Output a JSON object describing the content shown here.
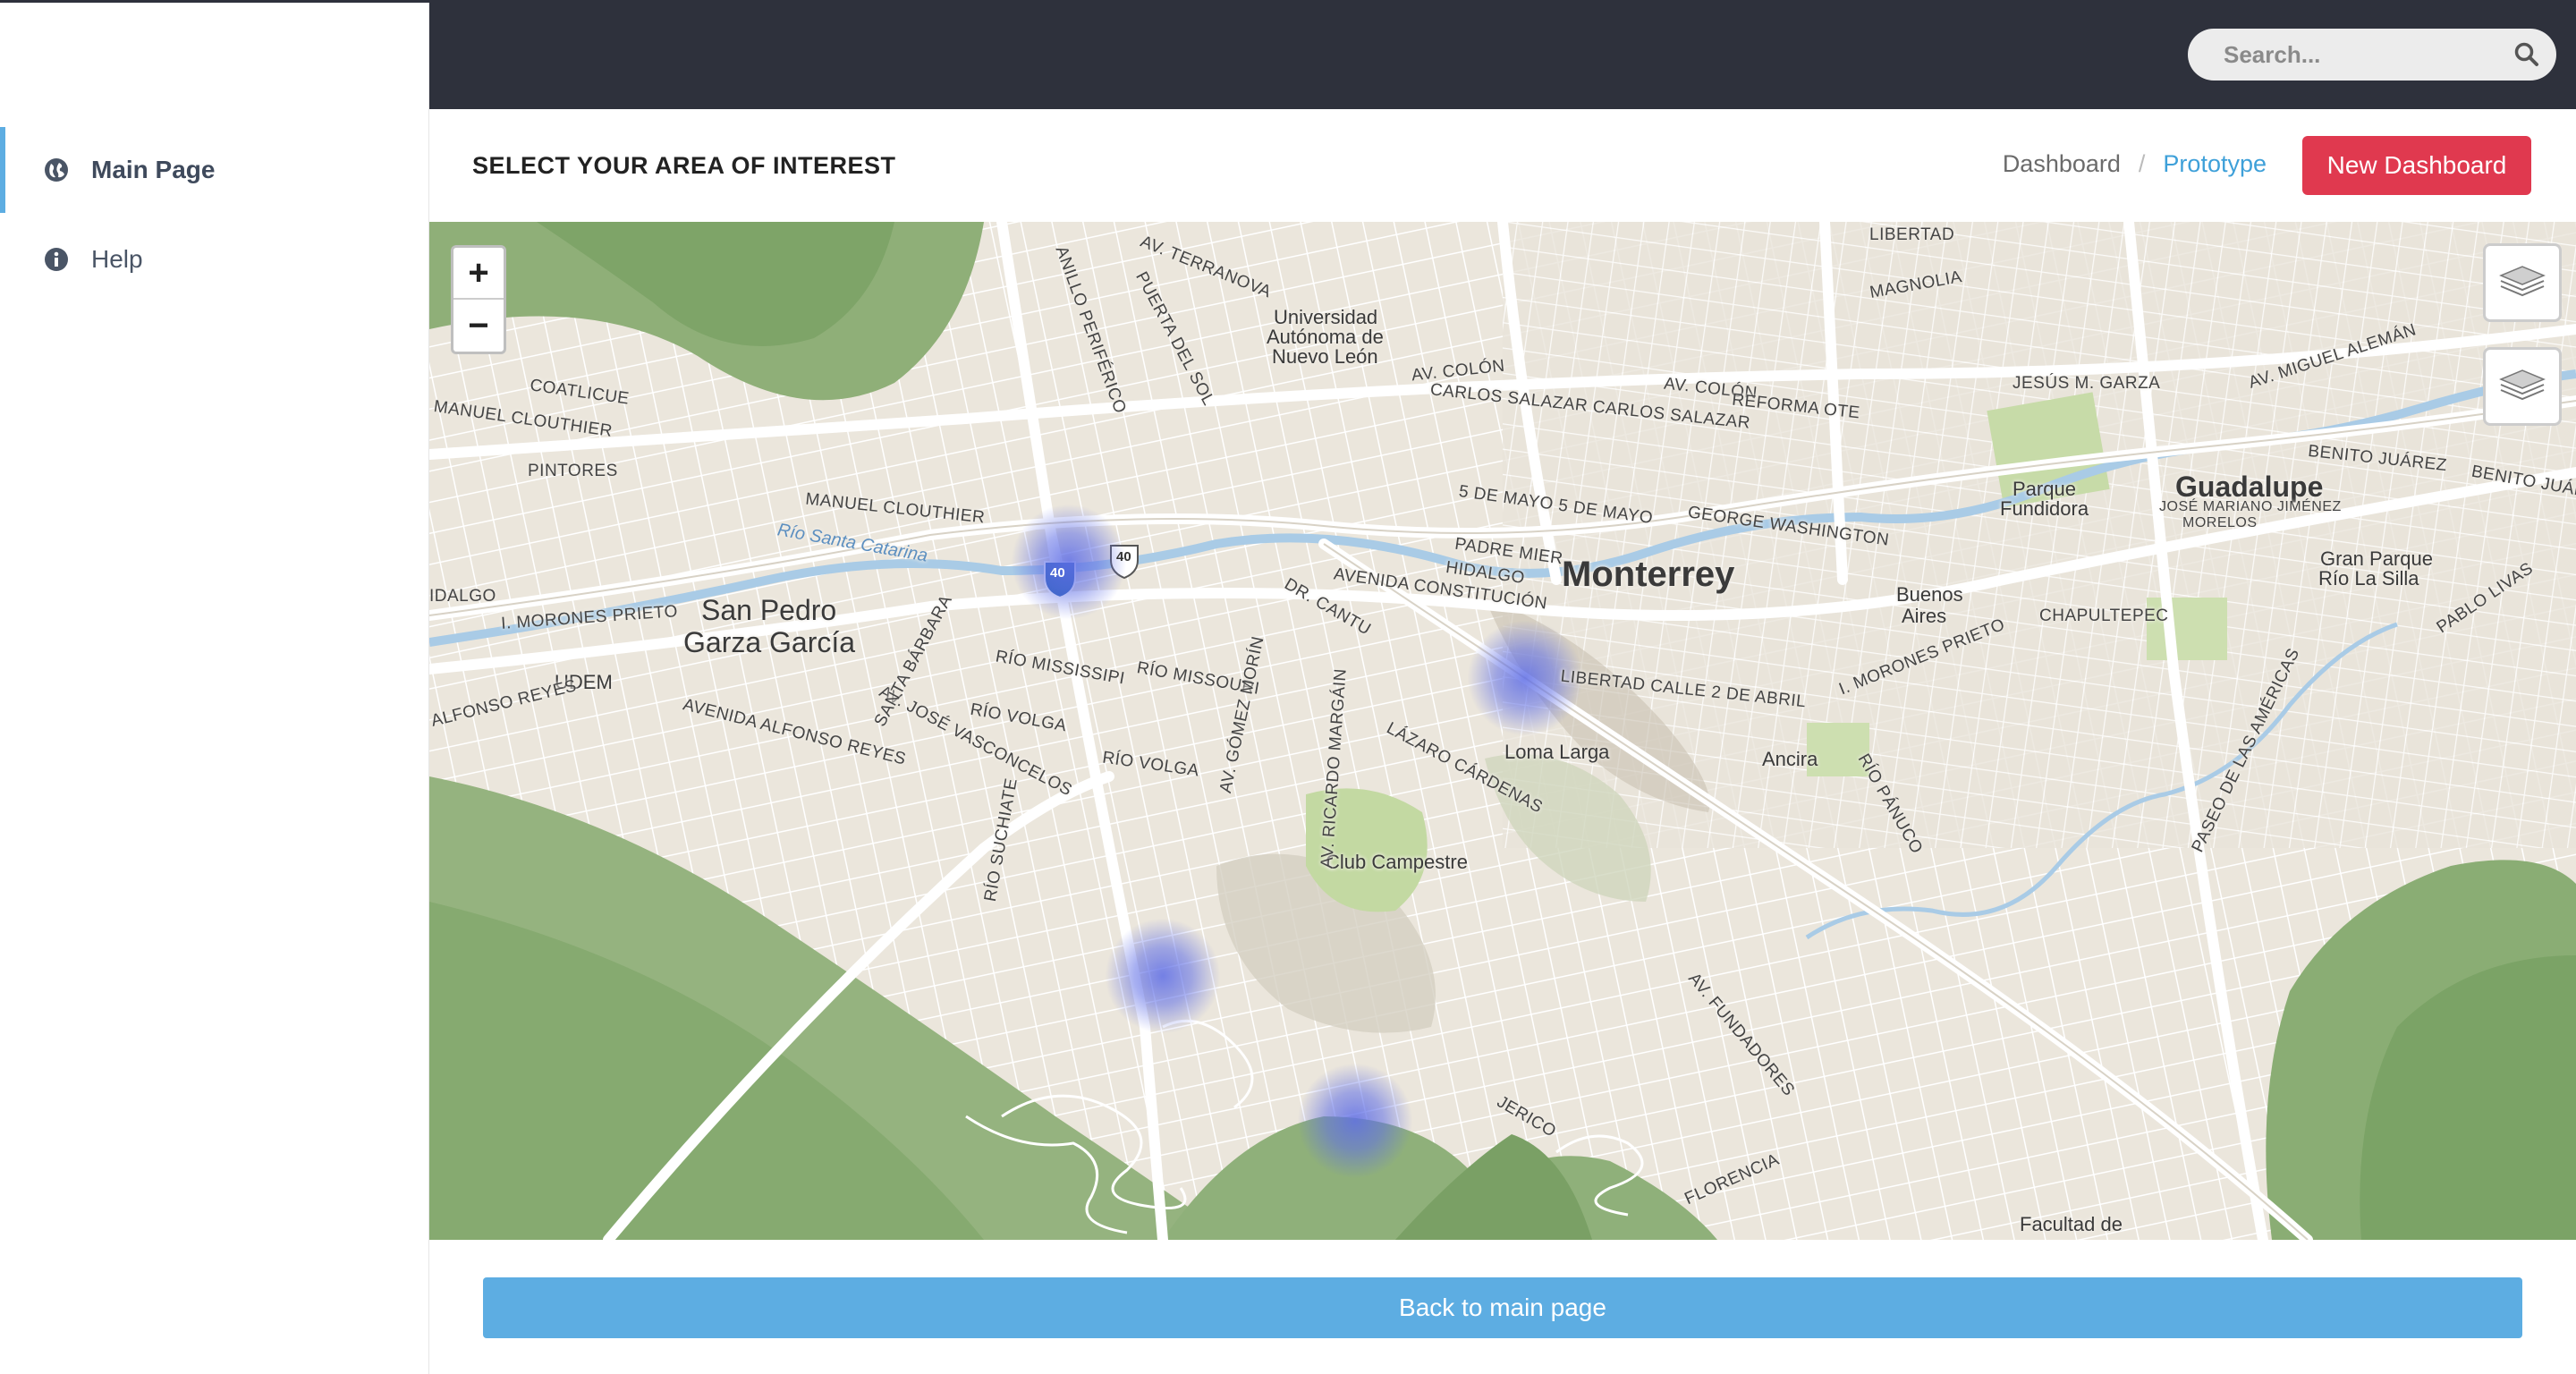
{
  "sidebar": {
    "items": [
      {
        "label": "Main Page",
        "icon": "globe-icon",
        "active": true
      },
      {
        "label": "Help",
        "icon": "info-icon",
        "active": false
      }
    ]
  },
  "topbar": {
    "search_placeholder": "Search..."
  },
  "header": {
    "title": "SELECT YOUR AREA OF INTEREST",
    "breadcrumb": [
      "Dashboard",
      "Prototype"
    ],
    "breadcrumb_separator": "/",
    "new_button": "New Dashboard"
  },
  "map": {
    "zoom_in": "+",
    "zoom_out": "−",
    "labels": {
      "city_monterrey": "Monterrey",
      "city_guadalupe": "Guadalupe",
      "city_san_pedro_1": "San Pedro",
      "city_san_pedro_2": "Garza García",
      "uni_1": "Universidad",
      "uni_2": "Autónoma de",
      "uni_3": "Nuevo León",
      "loma_larga": "Loma Larga",
      "club_campestre": "Club Campestre",
      "ancira": "Ancira",
      "buenos_aires_1": "Buenos",
      "buenos_aires_2": "Aires",
      "parque_fundidora_1": "Parque",
      "parque_fundidora_2": "Fundidora",
      "gran_parque_1": "Gran Parque",
      "gran_parque_2": "Río La Silla",
      "udem": "UDEM",
      "facultad": "Facultad de",
      "coatlicue": "COATLICUE",
      "manuel_clouthier": "MANUEL CLOUTHIER",
      "pintores": "PINTORES",
      "manuel_clouthier_2": "MANUEL CLOUTHIER",
      "rio_santa_catarina": "Río Santa Catarina",
      "morones_prieto": "I. MORONES PRIETO",
      "av_constitucion": "AVENIDA CONSTITUCIÓN",
      "av_colon": "AV. COLÓN",
      "av_colon_2": "AV. COLÓN",
      "carlos_salazar": "CARLOS SALAZAR CARLOS SALAZAR",
      "reforma": "REFORMA OTE",
      "cinco_mayo": "5 DE MAYO  5 DE MAYO",
      "george_washington": "GEORGE WASHINGTON",
      "padre_mier": "PADRE MIER",
      "hidalgo": "HIDALGO",
      "libertad": "LIBERTAD  CALLE 2 DE ABRIL",
      "lazaro_cardenas": "LÁZARO CÁRDENAS",
      "rio_mississipi": "RÍO MISSISSIPI",
      "rio_missouri": "RÍO MISSOURI",
      "rio_volga": "RÍO VOLGA",
      "rio_volga_2": "RÍO VOLGA",
      "alfonso_reyes": "AVENIDA ALFONSO REYES",
      "jose_vasconcelos": "AV. JOSÉ VASCONCELOS",
      "chapultepec": "CHAPULTEPEC",
      "av_fundadores": "AV. FUNDADORES",
      "jerico": "JERICO",
      "florencia": "FLORENCIA",
      "rio_panuco": "RÍO PÁNUCO",
      "paseo_americas": "PASEO DE LAS AMÉRICAS",
      "magnolia": "MAGNOLIA",
      "jesus_garza": "JESÚS M. GARZA",
      "miguel_aleman": "AV. MIGUEL ALEMÁN",
      "benito_juarez": "BENITO JUÁREZ",
      "benito_juarez_2": "BENITO JUÁREZ",
      "jose_mariano": "JOSÉ MARIANO JIMÉNEZ",
      "morelos": "MORELOS",
      "pablo_livas": "PABLO LIVAS",
      "terranova": "AV. TERRANOVA",
      "anillo_periferico": "ANILLO PERIFÉRICO",
      "puerta_sol": "PUERTA DEL SOL",
      "santa_barbara": "SANTA BÁRBARA",
      "rio_suchiate": "RÍO SUCHIATE",
      "dr_cantu": "DR. CANTU",
      "ricardo_margain": "AV. RICARDO MARGÁIN",
      "gomez_morin": "AV. GÓMEZ MORÍN",
      "hidalgo_w": "IDALGO",
      "alfonso_reyes_w": "ALFONSO REYES",
      "morones_prieto_w": "I. MORONES PRIETO",
      "libertad_n": "LIBERTAD",
      "highway_40": "40",
      "highway_40b": "40"
    }
  },
  "footer": {
    "back_button": "Back to main page"
  },
  "colors": {
    "topbar": "#2e313c",
    "accent_blue": "#5dade2",
    "danger_red": "#e0394f",
    "breadcrumb_active": "#3ea0d9",
    "heat_spot": "#5f6ee6"
  }
}
